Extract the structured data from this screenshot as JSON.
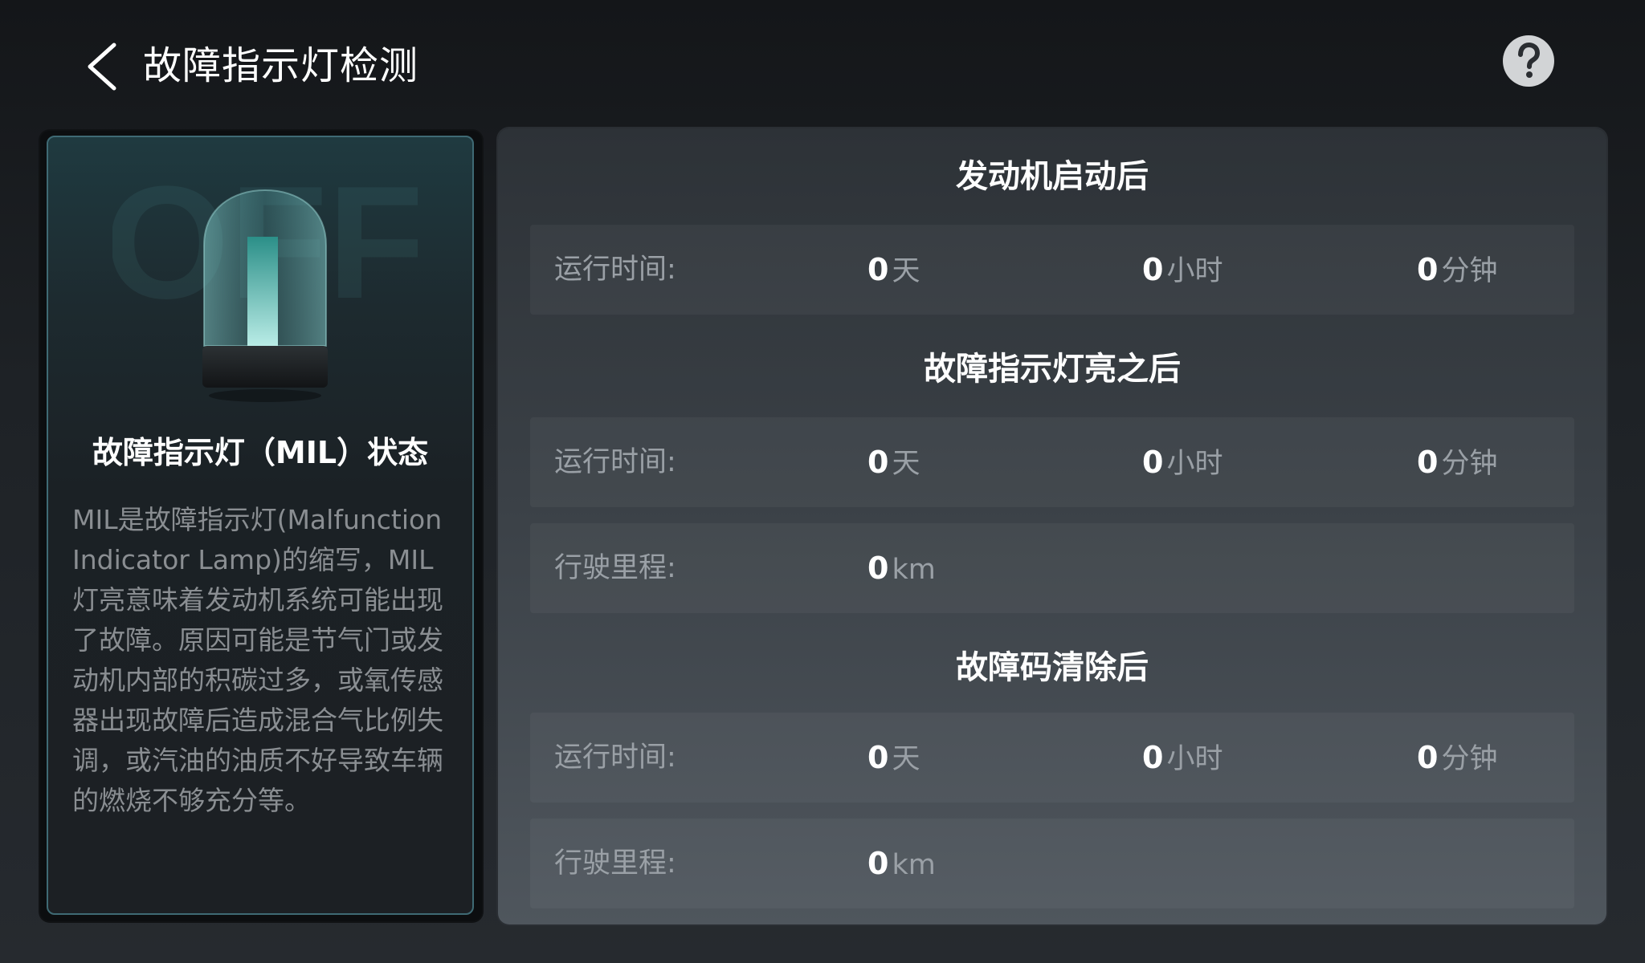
{
  "header": {
    "title": "故障指示灯检测"
  },
  "left_card": {
    "lamp_state": "OFF",
    "mil_title": "故障指示灯（MIL）状态",
    "description": "MIL是故障指示灯(Malfunction Indicator Lamp)的缩写，MIL灯亮意味着发动机系统可能出现了故障。原因可能是节气门或发动机内部的积碳过多，或氧传感器出现故障后造成混合气比例失调，或汽油的油质不好导致车辆的燃烧不够充分等。"
  },
  "sections": {
    "after_engine_start": {
      "title": "发动机启动后",
      "runtime": {
        "label": "运行时间:",
        "days": "0",
        "days_unit": "天",
        "hours": "0",
        "hours_unit": "小时",
        "minutes": "0",
        "minutes_unit": "分钟"
      }
    },
    "after_mil_on": {
      "title": "故障指示灯亮之后",
      "runtime": {
        "label": "运行时间:",
        "days": "0",
        "days_unit": "天",
        "hours": "0",
        "hours_unit": "小时",
        "minutes": "0",
        "minutes_unit": "分钟"
      },
      "mileage": {
        "label": "行驶里程:",
        "value": "0",
        "unit": "km"
      }
    },
    "after_code_clear": {
      "title": "故障码清除后",
      "runtime": {
        "label": "运行时间:",
        "days": "0",
        "days_unit": "天",
        "hours": "0",
        "hours_unit": "小时",
        "minutes": "0",
        "minutes_unit": "分钟"
      },
      "mileage": {
        "label": "行驶里程:",
        "value": "0",
        "unit": "km"
      }
    }
  },
  "icons": {
    "back": "chevron-left-icon",
    "help": "question-mark-icon",
    "lamp": "indicator-lamp-icon"
  },
  "colors": {
    "lamp_glow": "#8fd3d0",
    "card_border": "#3f6a74",
    "help_bg": "#d2d4d6"
  }
}
